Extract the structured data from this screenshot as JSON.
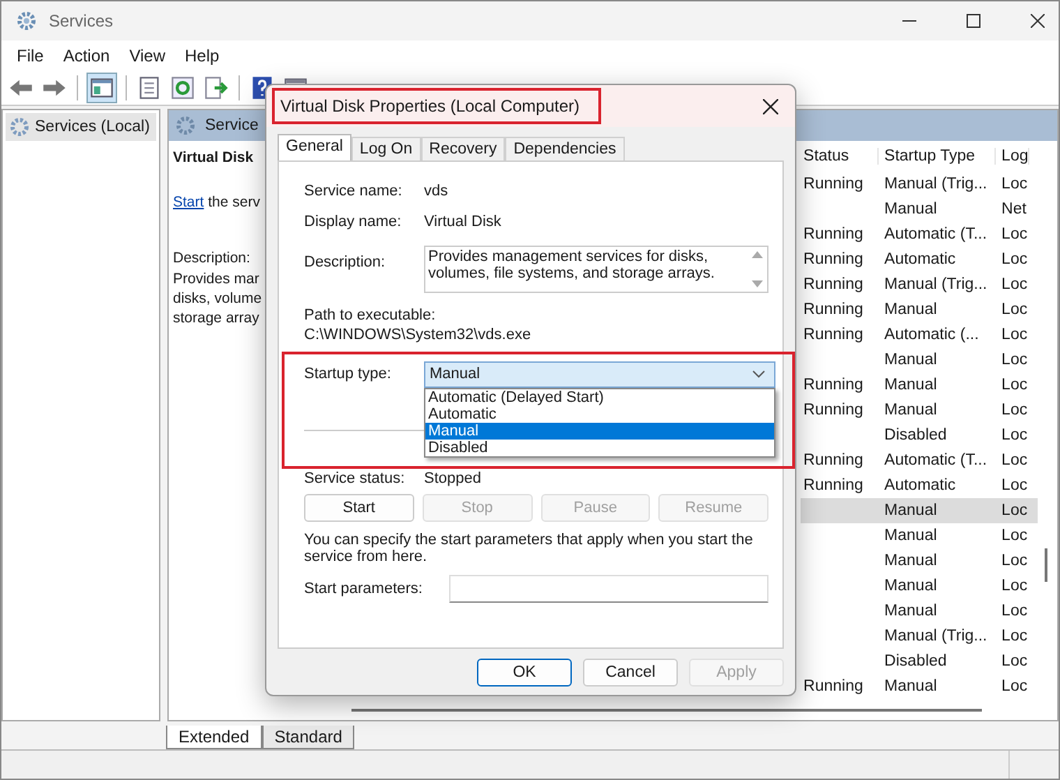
{
  "window": {
    "title": "Services"
  },
  "menu": [
    "File",
    "Action",
    "View",
    "Help"
  ],
  "tree": [
    {
      "label": "Services (Local)",
      "selected": true
    }
  ],
  "pane": {
    "header": "Service",
    "title": "Virtual Disk",
    "link": "Start",
    "link_rest": "the serv",
    "description_label": "Description:",
    "description_lines": [
      "Provides mar",
      "disks, volume",
      "storage array"
    ]
  },
  "list": {
    "columns": [
      "Status",
      "Startup Type",
      "Log"
    ],
    "rows": [
      {
        "status": "Running",
        "startup_type": "Manual (Trig...",
        "log": "Loc",
        "selected": false
      },
      {
        "status": "",
        "startup_type": "Manual",
        "log": "Net",
        "selected": false
      },
      {
        "status": "Running",
        "startup_type": "Automatic (T...",
        "log": "Loc",
        "selected": false
      },
      {
        "status": "Running",
        "startup_type": "Automatic",
        "log": "Loc",
        "selected": false
      },
      {
        "status": "Running",
        "startup_type": "Manual (Trig...",
        "log": "Loc",
        "selected": false
      },
      {
        "status": "Running",
        "startup_type": "Manual",
        "log": "Loc",
        "selected": false
      },
      {
        "status": "Running",
        "startup_type": "Automatic (...",
        "log": "Loc",
        "selected": false
      },
      {
        "status": "",
        "startup_type": "Manual",
        "log": "Loc",
        "selected": false
      },
      {
        "status": "Running",
        "startup_type": "Manual",
        "log": "Loc",
        "selected": false
      },
      {
        "status": "Running",
        "startup_type": "Manual",
        "log": "Loc",
        "selected": false
      },
      {
        "status": "",
        "startup_type": "Disabled",
        "log": "Loc",
        "selected": false
      },
      {
        "status": "Running",
        "startup_type": "Automatic (T...",
        "log": "Loc",
        "selected": false
      },
      {
        "status": "Running",
        "startup_type": "Automatic",
        "log": "Loc",
        "selected": false
      },
      {
        "status": "",
        "startup_type": "Manual",
        "log": "Loc",
        "selected": true
      },
      {
        "status": "",
        "startup_type": "Manual",
        "log": "Loc",
        "selected": false
      },
      {
        "status": "",
        "startup_type": "Manual",
        "log": "Loc",
        "selected": false
      },
      {
        "status": "",
        "startup_type": "Manual",
        "log": "Loc",
        "selected": false
      },
      {
        "status": "",
        "startup_type": "Manual",
        "log": "Loc",
        "selected": false
      },
      {
        "status": "",
        "startup_type": "Manual (Trig...",
        "log": "Loc",
        "selected": false
      },
      {
        "status": "",
        "startup_type": "Disabled",
        "log": "Loc",
        "selected": false
      },
      {
        "status": "Running",
        "startup_type": "Manual",
        "log": "Loc",
        "selected": false
      }
    ]
  },
  "bottom_tabs": [
    {
      "label": "Extended",
      "selected": true
    },
    {
      "label": "Standard",
      "selected": false
    }
  ],
  "dialog": {
    "title": "Virtual Disk Properties (Local Computer)",
    "tabs": [
      {
        "label": "General",
        "selected": true
      },
      {
        "label": "Log On",
        "selected": false
      },
      {
        "label": "Recovery",
        "selected": false
      },
      {
        "label": "Dependencies",
        "selected": false
      }
    ],
    "service_name_label": "Service name:",
    "service_name": "vds",
    "display_name_label": "Display name:",
    "display_name": "Virtual Disk",
    "description_label": "Description:",
    "description": "Provides management services for disks, volumes, file systems, and storage arrays.",
    "path_label": "Path to executable:",
    "path": "C:\\WINDOWS\\System32\\vds.exe",
    "startup_label": "Startup type:",
    "startup_value": "Manual",
    "startup_options": [
      {
        "label": "Automatic (Delayed Start)",
        "selected": false
      },
      {
        "label": "Automatic",
        "selected": false
      },
      {
        "label": "Manual",
        "selected": true
      },
      {
        "label": "Disabled",
        "selected": false
      }
    ],
    "status_label": "Service status:",
    "status_value": "Stopped",
    "service_buttons": [
      {
        "label": "Start",
        "disabled": false
      },
      {
        "label": "Stop",
        "disabled": true
      },
      {
        "label": "Pause",
        "disabled": true
      },
      {
        "label": "Resume",
        "disabled": true
      }
    ],
    "note": "You can specify the start parameters that apply when you start the service from here.",
    "parameters_label": "Start parameters:",
    "footer_buttons": [
      {
        "label": "OK",
        "disabled": false,
        "default": true
      },
      {
        "label": "Cancel",
        "disabled": false,
        "default": false
      },
      {
        "label": "Apply",
        "disabled": true,
        "default": false
      }
    ]
  }
}
